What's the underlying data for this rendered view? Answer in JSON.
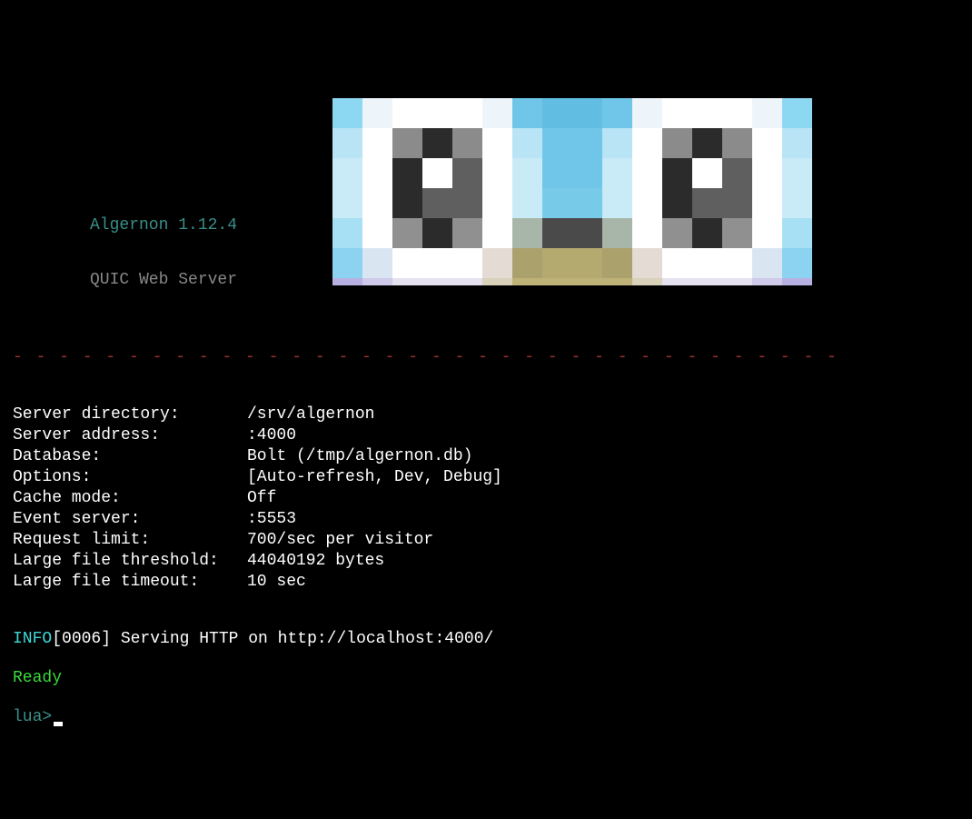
{
  "header": {
    "title": "Algernon 1.12.4",
    "subtitle": "QUIC Web Server"
  },
  "divider": "- - - - - - - - - - - - - - - - - - - - - - - - - - - - - - - - - - - -",
  "rows": [
    {
      "key": "Server directory:",
      "val": "/srv/algernon"
    },
    {
      "key": "Server address:",
      "val": ":4000"
    },
    {
      "key": "Database:",
      "val": "Bolt (/tmp/algernon.db)"
    },
    {
      "key": "Options:",
      "val": "[Auto-refresh, Dev, Debug]"
    },
    {
      "key": "Cache mode:",
      "val": "Off"
    },
    {
      "key": "Event server:",
      "val": ":5553"
    },
    {
      "key": "Request limit:",
      "val": "700/sec per visitor"
    },
    {
      "key": "Large file threshold:",
      "val": "44040192 bytes"
    },
    {
      "key": "Large file timeout:",
      "val": "10 sec"
    }
  ],
  "log": {
    "level": "INFO",
    "message": "[0006] Serving HTTP on http://localhost:4000/"
  },
  "ready": "Ready",
  "prompt": "lua>"
}
